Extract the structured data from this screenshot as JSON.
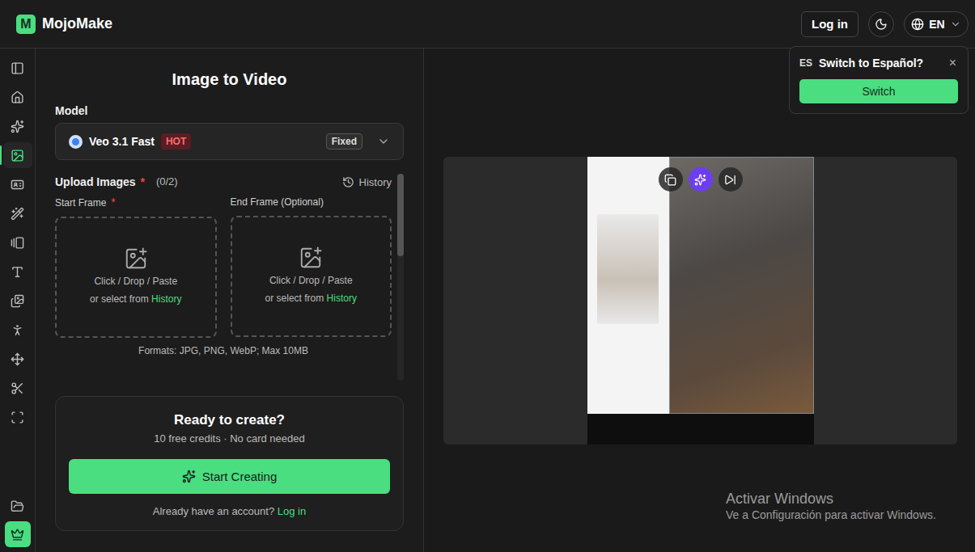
{
  "header": {
    "logo_mark": "M",
    "brand": "MojoMake",
    "login": "Log in",
    "language": "EN"
  },
  "language_prompt": {
    "code": "ES",
    "question": "Switch to Español?",
    "close": "×",
    "button": "Switch"
  },
  "rail": {
    "items": [
      {
        "selected": false
      },
      {
        "selected": false
      },
      {
        "selected": false
      },
      {
        "selected": true
      },
      {
        "selected": false
      },
      {
        "selected": false
      },
      {
        "selected": false
      },
      {
        "selected": false
      },
      {
        "selected": false
      },
      {
        "selected": false
      },
      {
        "selected": false
      },
      {
        "selected": false
      },
      {
        "selected": false
      }
    ],
    "bottom": [
      {
        "kind": "plain"
      },
      {
        "kind": "premium"
      }
    ]
  },
  "panel": {
    "title": "Image to Video",
    "model_label": "Model",
    "model": {
      "name": "Veo 3.1 Fast",
      "badge": "HOT",
      "tag": "Fixed"
    },
    "upload": {
      "label": "Upload Images",
      "required_mark": "*",
      "count": "(0/2)",
      "history": "History",
      "frames": [
        {
          "label": "Start Frame",
          "required": true
        },
        {
          "label": "End Frame (Optional)",
          "required": false
        }
      ],
      "drop_text": "Click / Drop / Paste",
      "select_text": "or select from",
      "select_link": "History",
      "formats": "Formats: JPG, PNG, WebP; Max 10MB",
      "scroll_level": 0.4
    },
    "cta": {
      "title": "Ready to create?",
      "subtitle": "10 free credits · No card needed",
      "button": "Start Creating",
      "account_prompt": "Already have an account?",
      "login": "Log in"
    }
  },
  "preview": {
    "overlay_buttons": [
      {
        "selected": false
      },
      {
        "selected": true
      },
      {
        "selected": false
      }
    ]
  },
  "watermark": {
    "title": "Activar Windows",
    "subtitle": "Ve a Configuración para activar Windows."
  }
}
